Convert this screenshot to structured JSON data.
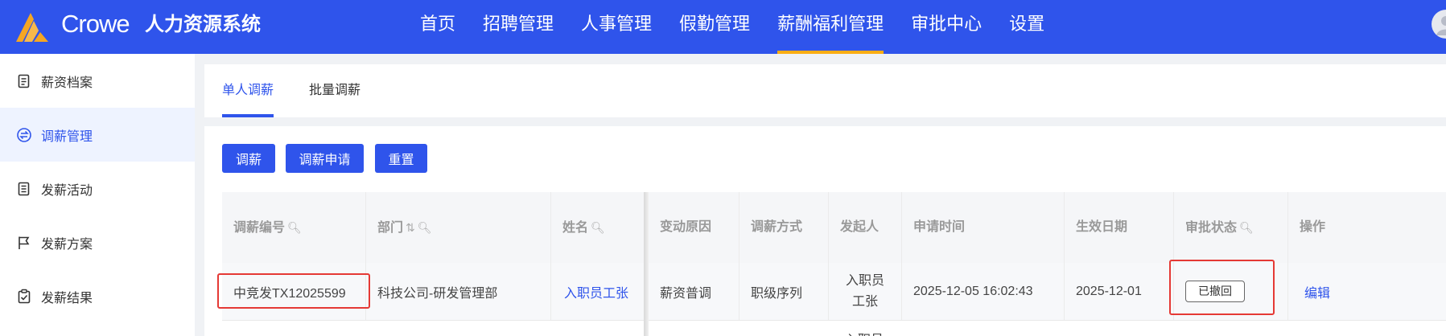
{
  "header": {
    "brand": "Crowe",
    "system_title": "人力资源系统",
    "nav": [
      "首页",
      "招聘管理",
      "人事管理",
      "假勤管理",
      "薪酬福利管理",
      "审批中心",
      "设置"
    ],
    "active_nav_index": 4,
    "accent_color": "#faad14",
    "bar_color": "#2f54eb"
  },
  "sidebar": {
    "items": [
      {
        "label": "薪资档案",
        "icon": "document-icon"
      },
      {
        "label": "调薪管理",
        "icon": "exchange-icon"
      },
      {
        "label": "发薪活动",
        "icon": "list-document-icon"
      },
      {
        "label": "发薪方案",
        "icon": "flag-icon"
      },
      {
        "label": "发薪结果",
        "icon": "clipboard-check-icon"
      }
    ],
    "active_index": 1
  },
  "tabs": {
    "items": [
      "单人调薪",
      "批量调薪"
    ],
    "active_index": 0
  },
  "toolbar": {
    "adjust_label": "调薪",
    "apply_label": "调薪申请",
    "reset_label": "重置"
  },
  "table": {
    "columns": [
      "调薪编号",
      "部门",
      "姓名",
      "变动原因",
      "调薪方式",
      "发起人",
      "申请时间",
      "生效日期",
      "审批状态",
      "操作"
    ],
    "rows": [
      {
        "id": "中竞发TX12025599",
        "department": "科技公司-研发管理部",
        "name": "入职员工张",
        "reason": "薪资普调",
        "method": "职级序列",
        "initiator_line1": "入职员",
        "initiator_line2": "工张",
        "apply_time": "2025-12-05 16:02:43",
        "effective_date": "2025-12-01",
        "status": "已撤回",
        "action": "编辑"
      }
    ],
    "next_row_partial": "入职员"
  }
}
